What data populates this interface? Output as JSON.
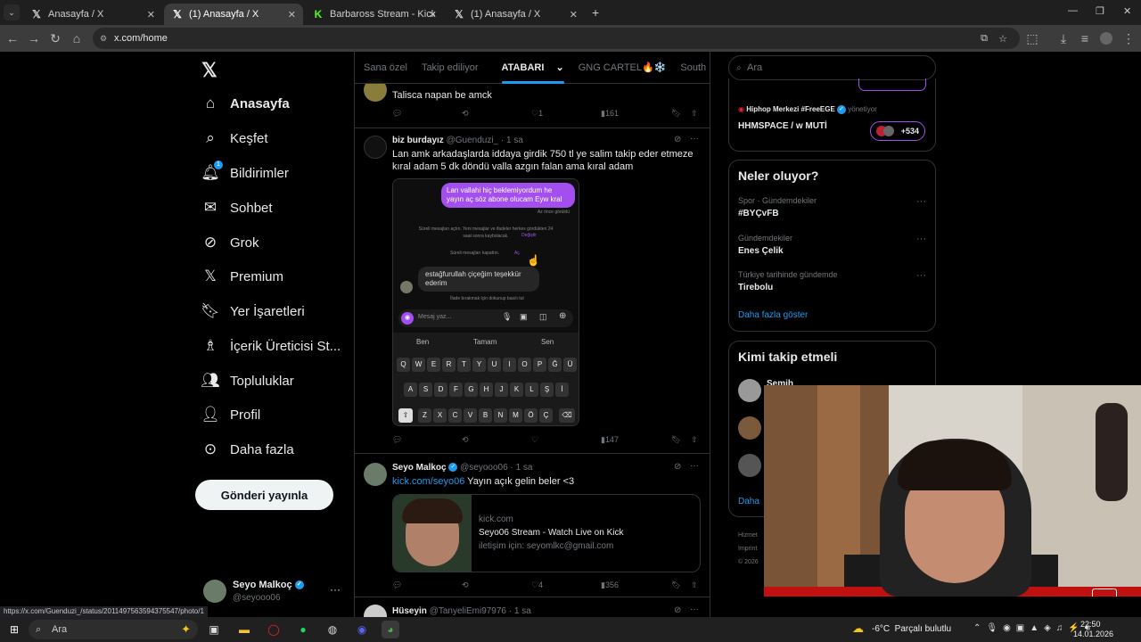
{
  "browser": {
    "tabs": [
      {
        "title": "Anasayfa / X",
        "icon": "x-logo-icon",
        "active": false
      },
      {
        "title": "(1) Anasayfa / X",
        "icon": "x-logo-icon",
        "active": true
      },
      {
        "title": "Barbaross Stream - Kick Dashbo",
        "icon": "kick-logo-icon",
        "active": false
      },
      {
        "title": "(1) Anasayfa / X",
        "icon": "x-logo-icon",
        "active": false
      }
    ],
    "url": "x.com/home",
    "status_url": "https://x.com/Guenduzi_/status/2011497563594375547/photo/1"
  },
  "sidebar": {
    "items": [
      {
        "label": "Anasayfa",
        "icon": "home-icon"
      },
      {
        "label": "Keşfet",
        "icon": "search-icon"
      },
      {
        "label": "Bildirimler",
        "icon": "bell-icon",
        "badge": "1"
      },
      {
        "label": "Sohbet",
        "icon": "mail-icon"
      },
      {
        "label": "Grok",
        "icon": "grok-icon"
      },
      {
        "label": "Premium",
        "icon": "x-logo-icon"
      },
      {
        "label": "Yer İşaretleri",
        "icon": "bookmark-icon"
      },
      {
        "label": "İçerik Üreticisi St...",
        "icon": "creator-icon"
      },
      {
        "label": "Topluluklar",
        "icon": "communities-icon"
      },
      {
        "label": "Profil",
        "icon": "profile-icon"
      },
      {
        "label": "Daha fazla",
        "icon": "more-circle-icon"
      }
    ],
    "post_button": "Gönderi yayınla",
    "account": {
      "name": "Seyo Malkoç",
      "handle": "@seyooo06"
    }
  },
  "feed": {
    "tabs": [
      "Sana özel",
      "Takip ediliyor",
      "ATABARI",
      "GNG CARTEL🔥❄️",
      "South Side"
    ],
    "active_tab": "ATABARI",
    "tweets": [
      {
        "text": "Talisca napan be amck",
        "likes": "1",
        "views": "161"
      },
      {
        "name": "biz burdayız",
        "handle": "@Guenduzi_",
        "time": "· 1 sa",
        "text": "Lan amk arkadaşlarda iddaya girdik 750 tl ye salim takip eder etmeze kıral adam 5 dk döndü valla azgın falan ama kıral adam",
        "views": "147",
        "media": {
          "bubble_sent": "Lan vallahi hiç beklemiyordum he yayın aç söz abone olucam Eyw kral",
          "seen": "Az önce görüldü",
          "notice": "Süreli mesajları açtın. Yeni mesajlar ve ifadeler herkes gördükten 24 saat sonra kaybolacak.",
          "notice_link": "Değiştir",
          "notice2": "Süreli mesajları kapattın.",
          "notice2_link": "Aç",
          "bubble_received": "estağfurullah çiçeğim teşekkür ederim",
          "hint": "İfade bırakmak için dokunup basılı tut",
          "input_placeholder": "Mesaj yaz...",
          "suggestions": [
            "Ben",
            "Tamam",
            "Sen"
          ],
          "keyboard_row1": [
            "Q",
            "W",
            "E",
            "R",
            "T",
            "Y",
            "U",
            "I",
            "O",
            "P",
            "Ğ",
            "Ü"
          ],
          "keyboard_row2": [
            "A",
            "S",
            "D",
            "F",
            "G",
            "H",
            "J",
            "K",
            "L",
            "Ş",
            "İ"
          ],
          "keyboard_row3": [
            "Z",
            "X",
            "C",
            "V",
            "B",
            "N",
            "M",
            "Ö",
            "Ç"
          ]
        }
      },
      {
        "name": "Seyo Malkoç",
        "handle": "@seyooo06",
        "time": "· 1 sa",
        "link": "kick.com/seyo06",
        "text": " Yayın açık gelin beler <3",
        "card": {
          "domain": "kick.com",
          "title": "Seyo06 Stream - Watch Live on Kick",
          "desc": "iletişim için: seyomlkc@gmail.com"
        },
        "likes": "4",
        "views": "356"
      },
      {
        "name": "Hüseyin",
        "handle": "@TanyeliEmi97976",
        "time": "· 1 sa"
      }
    ]
  },
  "right": {
    "search_placeholder": "Ara",
    "spaces": {
      "host": "Hiphop Merkezi #FreeEGE",
      "role": "yönetiyor",
      "title": "HHMSPACE / w MUTİ",
      "count": "+534"
    },
    "trends_title": "Neler oluyor?",
    "trends": [
      {
        "category": "Spor · Gündemdekiler",
        "name": "#BYÇvFB"
      },
      {
        "category": "Gündemdekiler",
        "name": "Enes Çelik"
      },
      {
        "category": "Türkiye tarihinde gündemde",
        "name": "Tirebolu"
      }
    ],
    "show_more": "Daha fazla göster",
    "who_to_follow_title": "Kimi takip etmeli",
    "follow_first": "Semih",
    "footer_partial": [
      "Hizmet",
      "Imprint",
      "© 2026"
    ],
    "daha_partial": "Daha"
  },
  "taskbar": {
    "search": "Ara",
    "weather": "-6°C  Parçalı bulutlu",
    "time": "22:50",
    "date": "14.01.2026"
  },
  "colors": {
    "accent": "#1d9bf0",
    "dm_purple": "#a34ff0",
    "kick_green": "#53fc18"
  }
}
